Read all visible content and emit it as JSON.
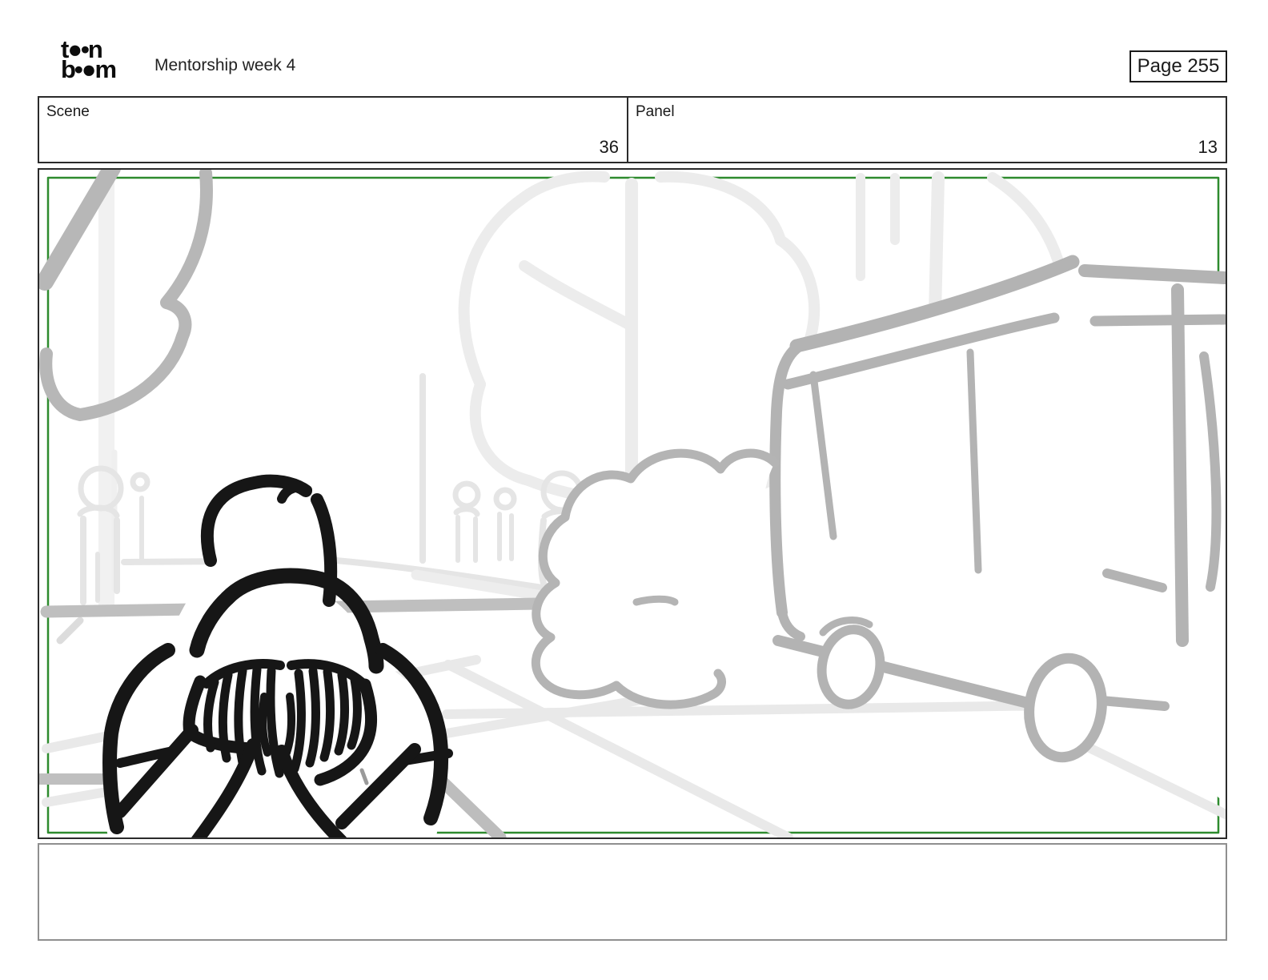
{
  "header": {
    "logo": {
      "line1": "t●•n",
      "line2": "b•●m"
    },
    "title": "Mentorship week 4",
    "page_label": "Page 255"
  },
  "meta": {
    "scene_label": "Scene",
    "scene_value": "36",
    "panel_label": "Panel",
    "panel_value": "13"
  },
  "caption": {
    "text": ""
  },
  "colors": {
    "accent_green": "#2e8b2e",
    "border_dark": "#2b2b2b",
    "caption_border": "#8f8f8f",
    "sketch_black": "#161616",
    "sketch_gray_medium": "#b5b5b5",
    "sketch_gray_light": "#ececec"
  }
}
